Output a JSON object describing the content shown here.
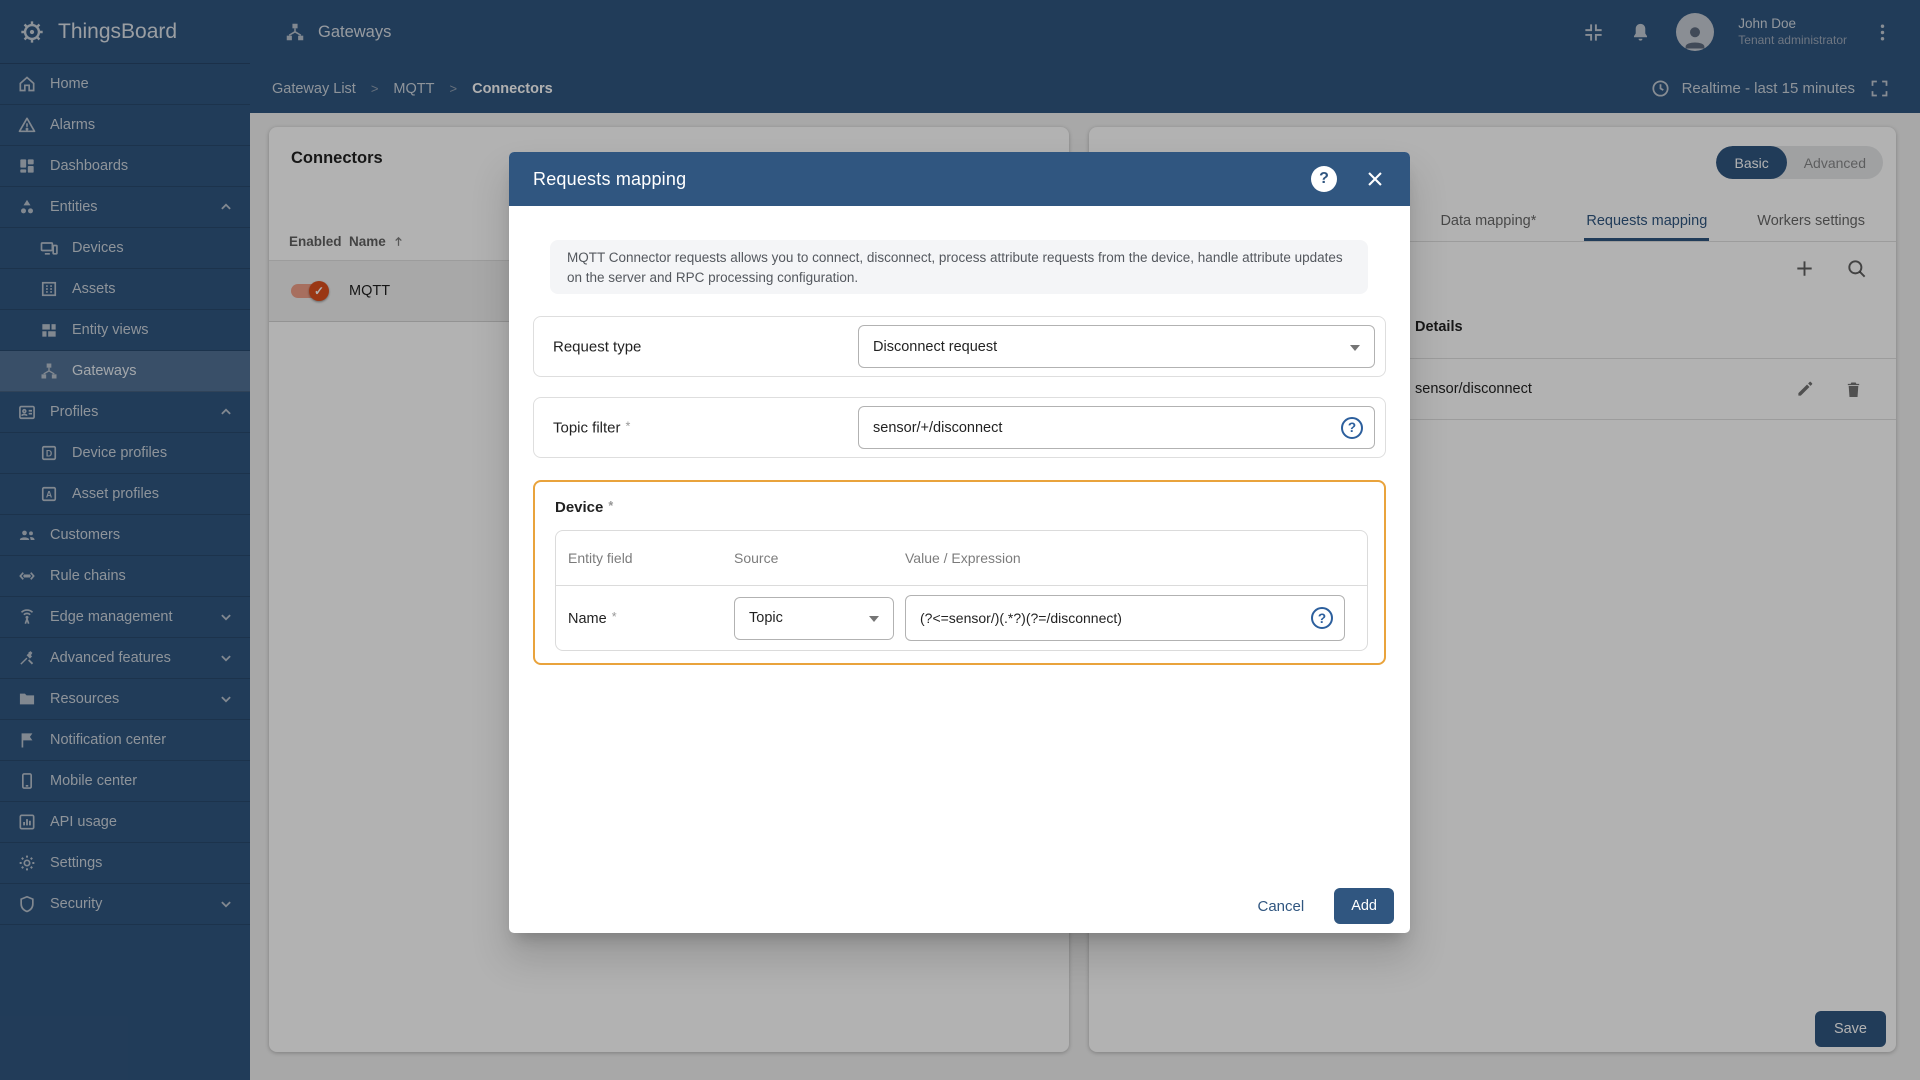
{
  "colors": {
    "primary": "#305680",
    "highlight_border": "#e9a33c",
    "toggle_thumb": "#dd4f1e",
    "toggle_track": "#efa089",
    "overlay": "rgba(0,0,0,0.30)"
  },
  "icons": {
    "check_glyph": "✓",
    "help_glyph": "?"
  },
  "sidebar": {
    "logo_text": "ThingsBoard",
    "items": [
      {
        "id": "home",
        "label": "Home",
        "icon": "home"
      },
      {
        "id": "alarms",
        "label": "Alarms",
        "icon": "alarms"
      },
      {
        "id": "dashboards",
        "label": "Dashboards",
        "icon": "dashboards"
      },
      {
        "id": "entities",
        "label": "Entities",
        "icon": "entities",
        "chevron": "up"
      },
      {
        "id": "devices",
        "label": "Devices",
        "icon": "devices",
        "indent": true
      },
      {
        "id": "assets",
        "label": "Assets",
        "icon": "assets",
        "indent": true
      },
      {
        "id": "entity-views",
        "label": "Entity views",
        "icon": "entity-views",
        "indent": true
      },
      {
        "id": "gateways",
        "label": "Gateways",
        "icon": "gateways",
        "indent": true,
        "selected": true
      },
      {
        "id": "profiles",
        "label": "Profiles",
        "icon": "profiles",
        "chevron": "up"
      },
      {
        "id": "device-profiles",
        "label": "Device profiles",
        "icon": "device-profiles",
        "indent": true
      },
      {
        "id": "asset-profiles",
        "label": "Asset profiles",
        "icon": "asset-profiles",
        "indent": true
      },
      {
        "id": "customers",
        "label": "Customers",
        "icon": "customers"
      },
      {
        "id": "rule-chains",
        "label": "Rule chains",
        "icon": "rule-chains"
      },
      {
        "id": "edge-management",
        "label": "Edge management",
        "icon": "edge",
        "chevron": "down"
      },
      {
        "id": "advanced-features",
        "label": "Advanced features",
        "icon": "advanced",
        "chevron": "down"
      },
      {
        "id": "resources",
        "label": "Resources",
        "icon": "resources",
        "chevron": "down"
      },
      {
        "id": "notification-center",
        "label": "Notification center",
        "icon": "notification"
      },
      {
        "id": "mobile-center",
        "label": "Mobile center",
        "icon": "mobile"
      },
      {
        "id": "api-usage",
        "label": "API usage",
        "icon": "api"
      },
      {
        "id": "settings",
        "label": "Settings",
        "icon": "settings"
      },
      {
        "id": "security",
        "label": "Security",
        "icon": "security",
        "chevron": "down"
      }
    ]
  },
  "topbar": {
    "title": "Gateways",
    "user": {
      "name": "John Doe",
      "role": "Tenant administrator"
    }
  },
  "breadcrumb": {
    "items": [
      "Gateway List",
      "MQTT",
      "Connectors"
    ],
    "separator": ">"
  },
  "toolbar": {
    "timewindow": "Realtime - last 15 minutes"
  },
  "connectors_panel": {
    "title": "Connectors",
    "col_enabled": "Enabled",
    "col_name": "Name",
    "rows": [
      {
        "name": "MQTT",
        "enabled": true
      }
    ]
  },
  "right_panel": {
    "mode_toggle": {
      "basic": "Basic",
      "advanced": "Advanced",
      "active": "basic"
    },
    "tabs": [
      {
        "label": "Data mapping*"
      },
      {
        "label": "Requests mapping",
        "active": true
      },
      {
        "label": "Workers settings"
      }
    ],
    "details_header": "Details",
    "rows": [
      "sensor/disconnect"
    ],
    "save_label": "Save"
  },
  "modal": {
    "title": "Requests mapping",
    "info": "MQTT Connector requests allows you to connect, disconnect, process attribute requests from the device, handle attribute updates on the server and RPC processing configuration.",
    "request_type": {
      "label": "Request type",
      "value": "Disconnect request"
    },
    "topic_filter": {
      "label": "Topic filter",
      "required": true,
      "value": "sensor/+/disconnect"
    },
    "device": {
      "label": "Device",
      "required": true,
      "columns": [
        "Entity field",
        "Source",
        "Value / Expression"
      ],
      "row": {
        "field": "Name",
        "required": true,
        "source": "Topic",
        "expression": "(?<=sensor/)(.*?)(?=/disconnect)"
      }
    },
    "cancel_label": "Cancel",
    "add_label": "Add"
  }
}
